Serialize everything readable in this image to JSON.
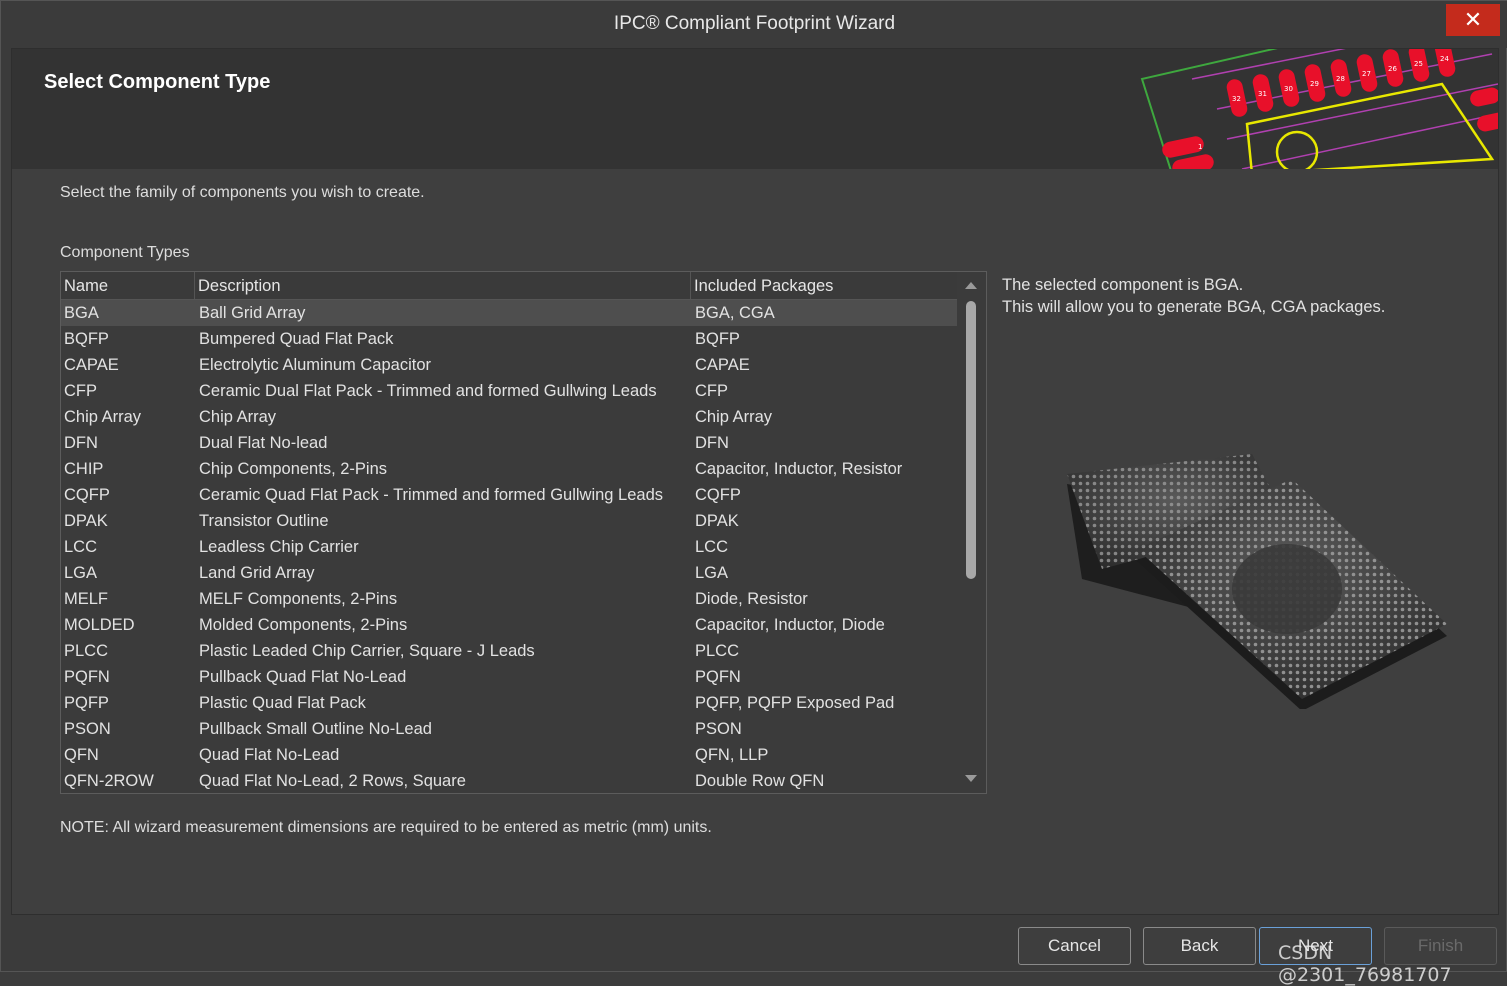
{
  "window": {
    "title": "IPC® Compliant Footprint Wizard",
    "close_label": "✕"
  },
  "header": {
    "title": "Select Component Type",
    "pad_labels": [
      "32",
      "31",
      "30",
      "29",
      "28",
      "27",
      "26",
      "25",
      "24",
      "1"
    ]
  },
  "instructions": "Select the family of components you wish to create.",
  "list": {
    "label": "Component Types",
    "columns": [
      "Name",
      "Description",
      "Included Packages"
    ],
    "rows": [
      {
        "name": "BGA",
        "description": "Ball Grid Array",
        "packages": "BGA, CGA",
        "selected": true
      },
      {
        "name": "BQFP",
        "description": "Bumpered Quad Flat Pack",
        "packages": "BQFP"
      },
      {
        "name": "CAPAE",
        "description": "Electrolytic Aluminum Capacitor",
        "packages": "CAPAE"
      },
      {
        "name": "CFP",
        "description": "Ceramic Dual Flat Pack - Trimmed and formed Gullwing Leads",
        "packages": "CFP"
      },
      {
        "name": "Chip Array",
        "description": "Chip Array",
        "packages": "Chip Array"
      },
      {
        "name": "DFN",
        "description": "Dual Flat No-lead",
        "packages": "DFN"
      },
      {
        "name": "CHIP",
        "description": "Chip Components, 2-Pins",
        "packages": "Capacitor, Inductor, Resistor"
      },
      {
        "name": "CQFP",
        "description": "Ceramic Quad Flat Pack - Trimmed and formed Gullwing Leads",
        "packages": "CQFP"
      },
      {
        "name": "DPAK",
        "description": "Transistor Outline",
        "packages": "DPAK"
      },
      {
        "name": "LCC",
        "description": "Leadless Chip Carrier",
        "packages": "LCC"
      },
      {
        "name": "LGA",
        "description": "Land Grid Array",
        "packages": "LGA"
      },
      {
        "name": "MELF",
        "description": "MELF Components, 2-Pins",
        "packages": "Diode, Resistor"
      },
      {
        "name": "MOLDED",
        "description": "Molded Components, 2-Pins",
        "packages": "Capacitor, Inductor, Diode"
      },
      {
        "name": "PLCC",
        "description": "Plastic Leaded Chip Carrier, Square - J Leads",
        "packages": "PLCC"
      },
      {
        "name": "PQFN",
        "description": "Pullback Quad Flat No-Lead",
        "packages": "PQFN"
      },
      {
        "name": "PQFP",
        "description": "Plastic Quad Flat Pack",
        "packages": "PQFP, PQFP Exposed Pad"
      },
      {
        "name": "PSON",
        "description": "Pullback Small Outline No-Lead",
        "packages": "PSON"
      },
      {
        "name": "QFN",
        "description": "Quad Flat No-Lead",
        "packages": "QFN, LLP"
      },
      {
        "name": "QFN-2ROW",
        "description": "Quad Flat No-Lead, 2 Rows, Square",
        "packages": "Double Row QFN"
      }
    ]
  },
  "info": {
    "line1": "The selected component is BGA.",
    "line2": "This will allow you to generate BGA, CGA packages."
  },
  "note": "NOTE: All wizard measurement dimensions are required to be entered as metric (mm) units.",
  "buttons": {
    "cancel": "Cancel",
    "back": "Back",
    "next": "Next",
    "finish": "Finish"
  },
  "watermark": "CSDN @2301_76981707",
  "colors": {
    "accent": "#6aa0d8",
    "close": "#c42b1c",
    "pad": "#e8102a",
    "silk": "#e8e800",
    "board_outline": "#3ea83e",
    "trace": "#b040b0"
  }
}
